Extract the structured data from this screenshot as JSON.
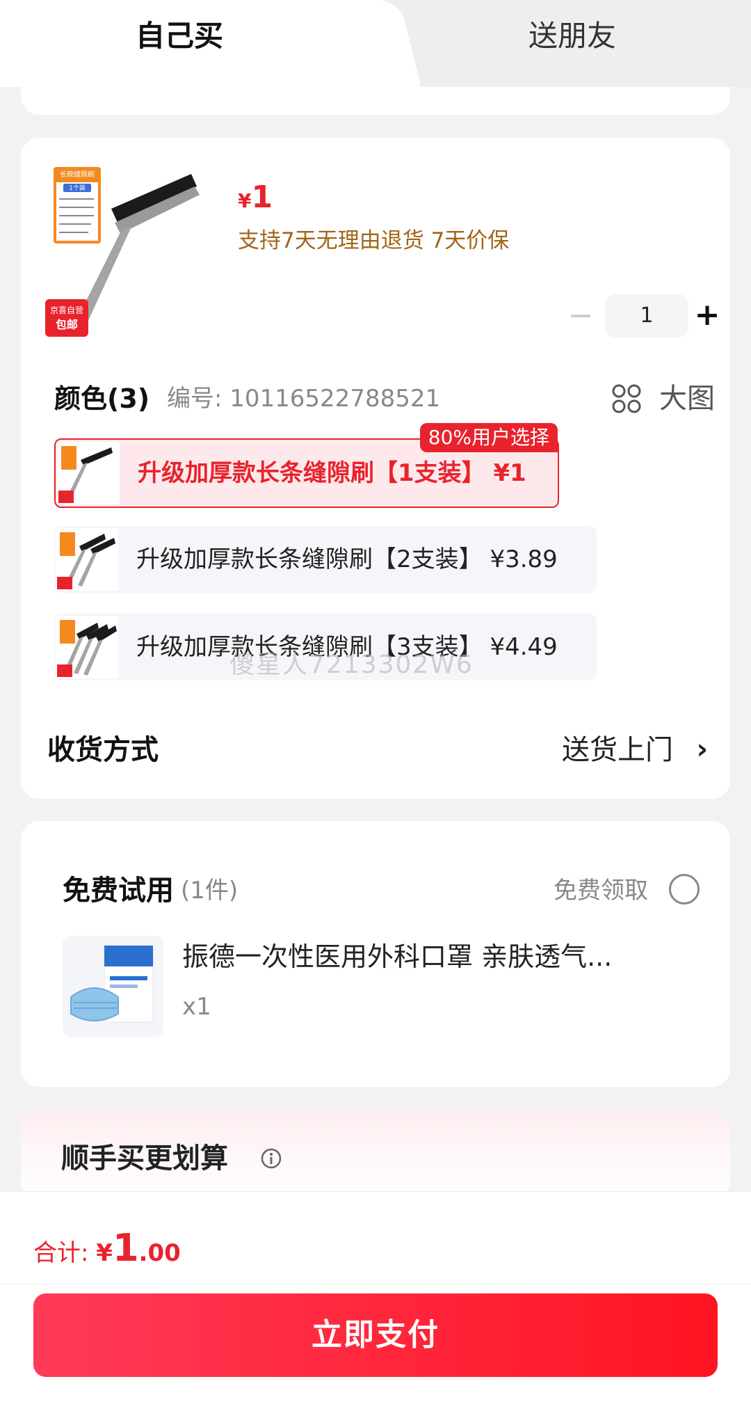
{
  "tabs": {
    "self": "自己买",
    "gift": "送朋友"
  },
  "product": {
    "image_labels": {
      "box_title": "长款缝隙刷",
      "box_sub": "1个装",
      "badge_top": "京喜自营",
      "badge_bottom": "包邮"
    },
    "price": "1",
    "currency": "¥",
    "service_note": "支持7天无理由退货  7天价保",
    "quantity": "1",
    "minus": "−",
    "plus": "+"
  },
  "color": {
    "title": "颜色(3)",
    "sku_code": "编号: 10116522788521",
    "big_image_label": "大图",
    "options": [
      {
        "label": "升级加厚款长条缝隙刷【1支装】 ¥1",
        "badge": "80%用户选择",
        "selected": true
      },
      {
        "label": "升级加厚款长条缝隙刷【2支装】 ¥3.89",
        "selected": false
      },
      {
        "label": "升级加厚款长条缝隙刷【3支装】 ¥4.49",
        "selected": false
      }
    ],
    "watermark": "傻星人7213302W6"
  },
  "delivery": {
    "title": "收货方式",
    "value": "送货上门",
    "chevron": "›"
  },
  "trial": {
    "title": "免费试用",
    "count": "(1件)",
    "claim": "免费领取",
    "item_name": "振德一次性医用外科口罩 亲肤透气...",
    "item_qty": "x1"
  },
  "addon": {
    "title": "顺手买更划算"
  },
  "footer": {
    "total_label": "合计:",
    "currency": "¥",
    "total_int": "1",
    "total_dec": ".00",
    "pay_button": "立即支付"
  },
  "colors": {
    "accent": "#e8232d",
    "service": "#a0661a",
    "pay_start": "#ff3a58",
    "pay_end": "#ff1422"
  }
}
